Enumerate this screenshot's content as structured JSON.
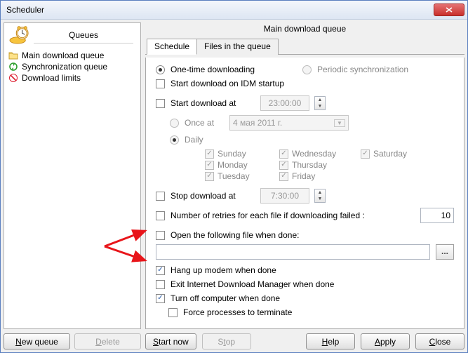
{
  "window": {
    "title": "Scheduler"
  },
  "sidebar": {
    "title": "Queues",
    "items": [
      {
        "label": "Main download queue"
      },
      {
        "label": "Synchronization queue"
      },
      {
        "label": "Download limits"
      }
    ],
    "new_queue_label": "New queue",
    "delete_label": "Delete"
  },
  "main": {
    "title": "Main download queue",
    "tabs": [
      {
        "label": "Schedule"
      },
      {
        "label": "Files in the queue"
      }
    ],
    "schedule": {
      "one_time_label": "One-time downloading",
      "periodic_label": "Periodic synchronization",
      "start_startup_label": "Start download on IDM startup",
      "start_at_label": "Start download at",
      "start_time": "23:00:00",
      "once_at_label": "Once at",
      "once_date": "4     мая    2011 г.",
      "daily_label": "Daily",
      "days": {
        "sun": "Sunday",
        "mon": "Monday",
        "tue": "Tuesday",
        "wed": "Wednesday",
        "thu": "Thursday",
        "fri": "Friday",
        "sat": "Saturday"
      },
      "stop_at_label": "Stop download at",
      "stop_time": "7:30:00",
      "retries_label": "Number of retries for each file if downloading failed :",
      "retries_value": "10",
      "open_file_label": "Open the following file when done:",
      "hangup_label": "Hang up modem when done",
      "exit_idm_label": "Exit Internet Download Manager when done",
      "turnoff_label": "Turn off computer when done",
      "force_label": "Force processes to terminate"
    },
    "buttons": {
      "start_now": "Start now",
      "stop": "Stop",
      "help": "Help",
      "apply": "Apply",
      "close": "Close"
    }
  }
}
